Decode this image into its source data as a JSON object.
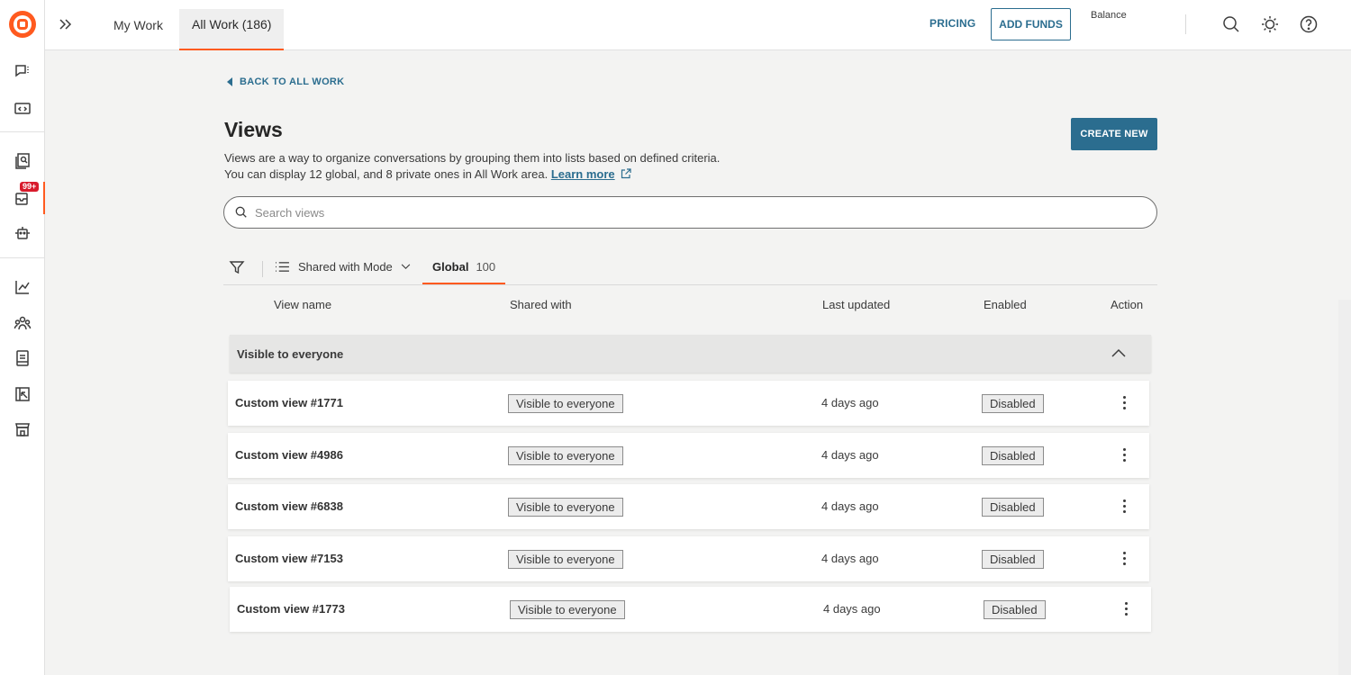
{
  "topbar": {
    "tabs": [
      {
        "label": "My Work"
      },
      {
        "label": "All Work (186)"
      }
    ],
    "pricing": "PRICING",
    "add_funds": "ADD FUNDS",
    "balance_label": "Balance"
  },
  "rail": {
    "badge": "99+",
    "icons": [
      "conversations-icon",
      "code-icon",
      "search-docs-icon",
      "inbox-icon",
      "bot-icon",
      "analytics-icon",
      "team-icon",
      "knowledge-icon",
      "reports-icon",
      "store-icon"
    ]
  },
  "page": {
    "back_label": "BACK TO ALL WORK",
    "title": "Views",
    "desc_line1": "Views are a way to organize conversations by grouping them into lists based on defined criteria.",
    "desc_line2": "You can display 12 global, and 8 private ones in All Work area.",
    "learn_more": "Learn more",
    "create_new": "CREATE NEW",
    "search_placeholder": "Search views",
    "shared_dropdown": "Shared with Mode",
    "global_tab": {
      "label": "Global",
      "count": "100"
    }
  },
  "table": {
    "headers": {
      "name": "View name",
      "shared": "Shared with",
      "updated": "Last updated",
      "enabled": "Enabled",
      "action": "Action"
    },
    "group_label": "Visible to everyone",
    "rows": [
      {
        "name": "Custom view #1771",
        "shared": "Visible to everyone",
        "updated": "4 days ago",
        "status": "Disabled"
      },
      {
        "name": "Custom view #4986",
        "shared": "Visible to everyone",
        "updated": "4 days ago",
        "status": "Disabled"
      },
      {
        "name": "Custom view #6838",
        "shared": "Visible to everyone",
        "updated": "4 days ago",
        "status": "Disabled"
      },
      {
        "name": "Custom view #7153",
        "shared": "Visible to everyone",
        "updated": "4 days ago",
        "status": "Disabled"
      },
      {
        "name": "Custom view #1773",
        "shared": "Visible to everyone",
        "updated": "4 days ago",
        "status": "Disabled"
      }
    ]
  },
  "colors": {
    "accent": "#ff5a1f",
    "primary": "#2b6d8f",
    "badge": "#d81b2c"
  }
}
